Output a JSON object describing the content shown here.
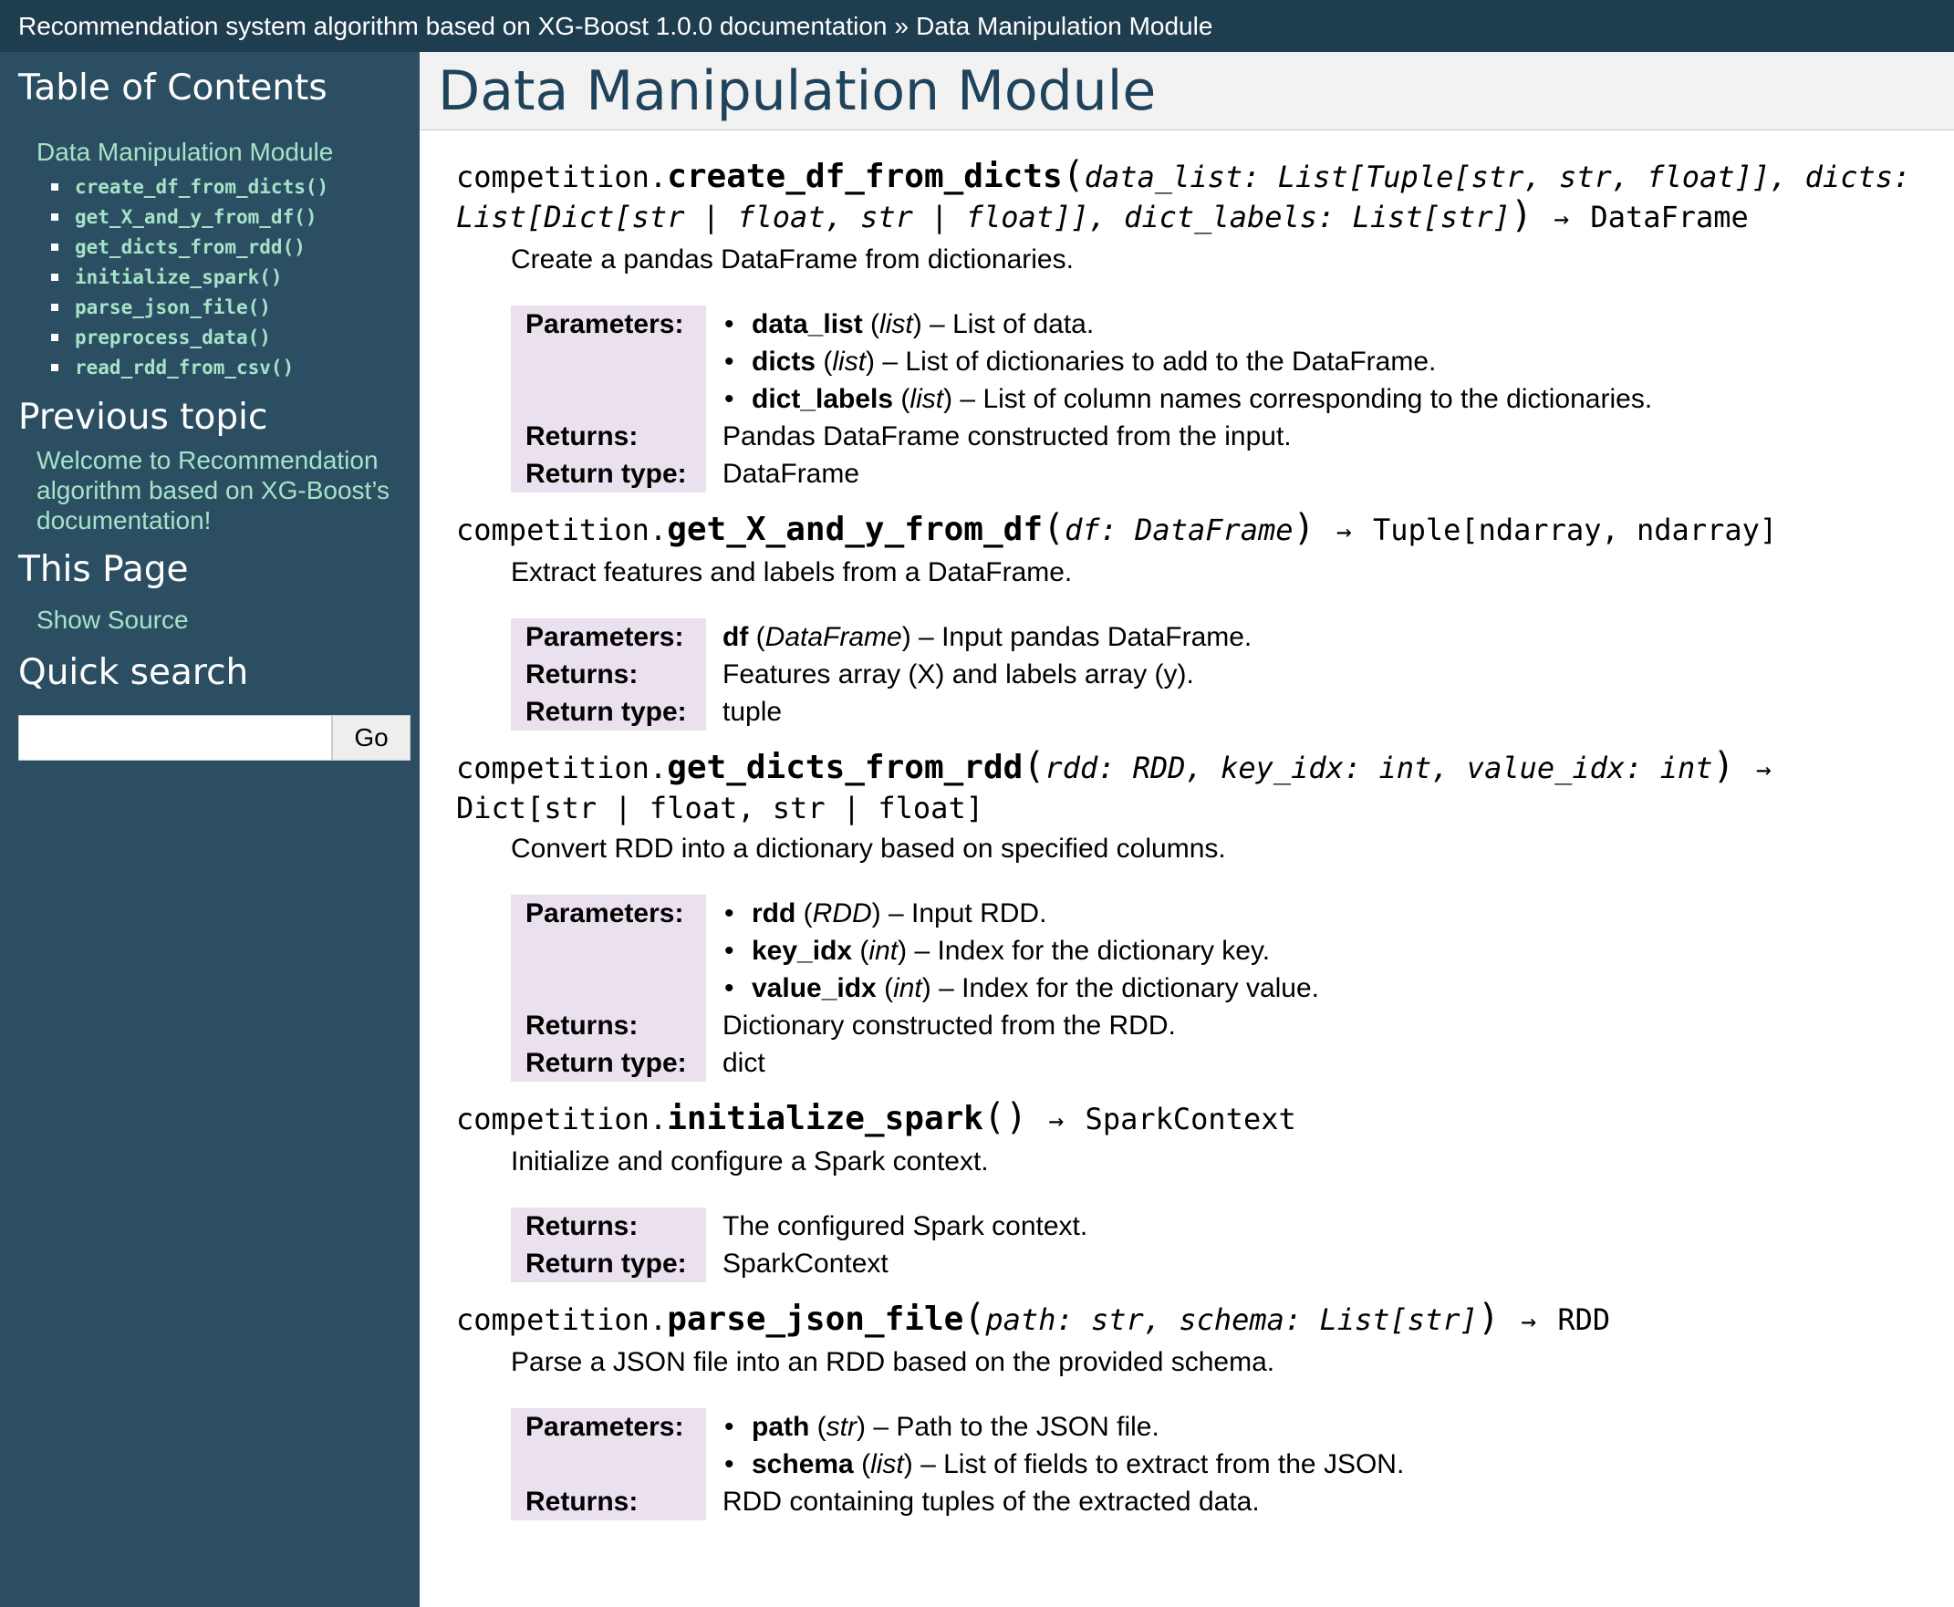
{
  "topbar": {
    "project": "Recommendation system algorithm based on XG-Boost 1.0.0 documentation",
    "separator": "»",
    "current": "Data Manipulation Module"
  },
  "sidebar": {
    "toc_heading": "Table of Contents",
    "toc_top": "Data Manipulation Module",
    "toc_items": [
      "create_df_from_dicts()",
      "get_X_and_y_from_df()",
      "get_dicts_from_rdd()",
      "initialize_spark()",
      "parse_json_file()",
      "preprocess_data()",
      "read_rdd_from_csv()"
    ],
    "prev_heading": "Previous topic",
    "prev_link": "Welcome to Recommendation algorithm based on XG-Boost’s documentation!",
    "thispage_heading": "This Page",
    "show_source": "Show Source",
    "search_heading": "Quick search",
    "search_value": "",
    "go_label": "Go"
  },
  "main": {
    "title": "Data Manipulation Module",
    "functions": [
      {
        "module": "competition.",
        "name": "create_df_from_dicts",
        "params": "data_list: List[Tuple[str, str, float]], dicts: List[Dict[str | float, str | float]], dict_labels: List[str]",
        "returns_sig": "DataFrame",
        "desc": "Create a pandas DataFrame from dictionaries.",
        "fields": {
          "parameters_label": "Parameters:",
          "params": [
            {
              "name": "data_list",
              "type": "list",
              "text": "List of data."
            },
            {
              "name": "dicts",
              "type": "list",
              "text": "List of dictionaries to add to the DataFrame."
            },
            {
              "name": "dict_labels",
              "type": "list",
              "text": "List of column names corresponding to the dictionaries."
            }
          ],
          "returns_label": "Returns:",
          "returns": "Pandas DataFrame constructed from the input.",
          "rtype_label": "Return type:",
          "rtype": "DataFrame"
        }
      },
      {
        "module": "competition.",
        "name": "get_X_and_y_from_df",
        "params": "df: DataFrame",
        "returns_sig": "Tuple[ndarray, ndarray]",
        "desc": "Extract features and labels from a DataFrame.",
        "fields": {
          "parameters_label": "Parameters:",
          "param_name": "df",
          "param_type": "DataFrame",
          "param_text": "Input pandas DataFrame.",
          "returns_label": "Returns:",
          "returns": "Features array (X) and labels array (y).",
          "rtype_label": "Return type:",
          "rtype": "tuple"
        }
      },
      {
        "module": "competition.",
        "name": "get_dicts_from_rdd",
        "params": "rdd: RDD, key_idx: int, value_idx: int",
        "returns_sig": "Dict[str | float, str | float]",
        "desc": "Convert RDD into a dictionary based on specified columns.",
        "fields": {
          "parameters_label": "Parameters:",
          "params": [
            {
              "name": "rdd",
              "type": "RDD",
              "text": "Input RDD."
            },
            {
              "name": "key_idx",
              "type": "int",
              "text": "Index for the dictionary key."
            },
            {
              "name": "value_idx",
              "type": "int",
              "text": "Index for the dictionary value."
            }
          ],
          "returns_label": "Returns:",
          "returns": "Dictionary constructed from the RDD.",
          "rtype_label": "Return type:",
          "rtype": "dict"
        }
      },
      {
        "module": "competition.",
        "name": "initialize_spark",
        "params": "",
        "returns_sig": "SparkContext",
        "desc": "Initialize and configure a Spark context.",
        "fields": {
          "returns_label": "Returns:",
          "returns": "The configured Spark context.",
          "rtype_label": "Return type:",
          "rtype": "SparkContext"
        }
      },
      {
        "module": "competition.",
        "name": "parse_json_file",
        "params": "path: str, schema: List[str]",
        "returns_sig": "RDD",
        "desc": "Parse a JSON file into an RDD based on the provided schema.",
        "fields": {
          "parameters_label": "Parameters:",
          "params": [
            {
              "name": "path",
              "type": "str",
              "text": "Path to the JSON file."
            },
            {
              "name": "schema",
              "type": "list",
              "text": "List of fields to extract from the JSON."
            }
          ],
          "returns_label": "Returns:",
          "returns": "RDD containing tuples of the extracted data."
        }
      }
    ],
    "arrow": "→",
    "dash": "–",
    "open_paren": "(",
    "close_paren": ")"
  }
}
